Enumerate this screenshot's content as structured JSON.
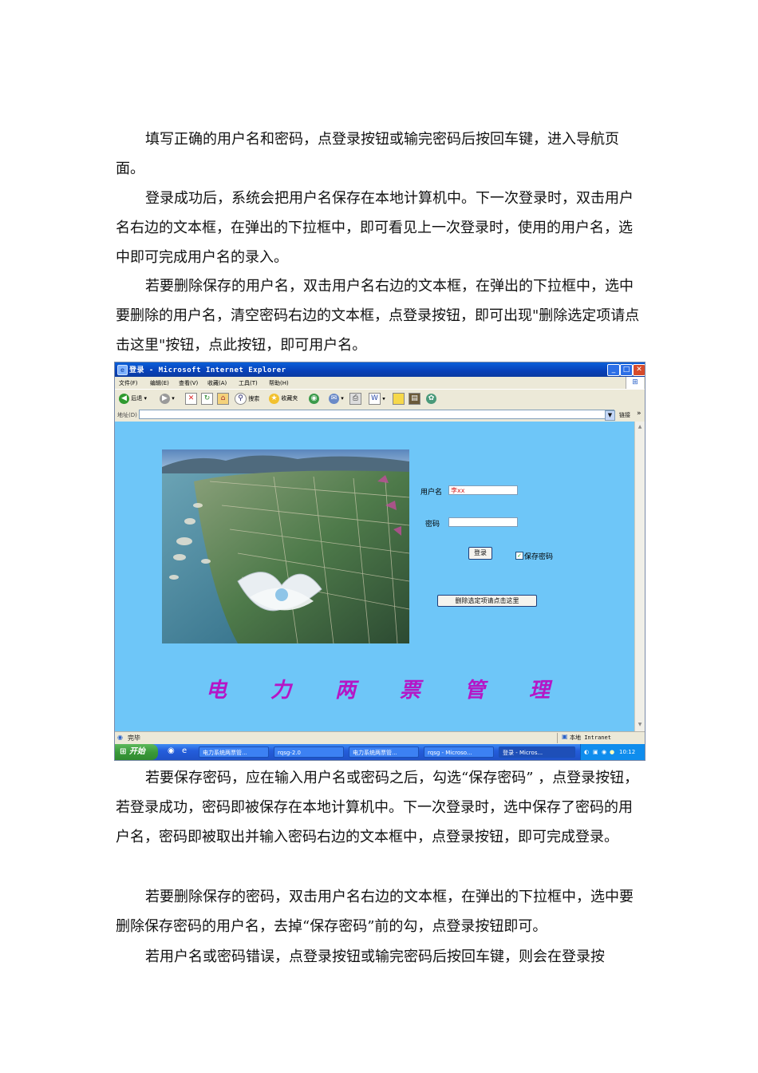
{
  "paragraphs": [
    "填写正确的用户名和密码，点登录按钮或输完密码后按回车键，进入导航页面。",
    "登录成功后，系统会把用户名保存在本地计算机中。下一次登录时，双击用户名右边的文本框，在弹出的下拉框中，即可看见上一次登录时，使用的用户名，选中即可完成用户名的录入。",
    "若要删除保存的用户名，双击用户名右边的文本框，在弹出的下拉框中，选中要删除的用户名，清空密码右边的文本框，点登录按钮，即可出现\"删除选定项请点击这里\"按钮，点此按钮，即可用户名。",
    "若要保存密码，应在输入用户名或密码之后，勾选“保存密码” ，点登录按钮，若登录成功，密码即被保存在本地计算机中。下一次登录时，选中保存了密码的用户名，密码即被取出并输入密码右边的文本框中，点登录按钮，即可完成登录。",
    "若要删除保存的密码，双击用户名右边的文本框，在弹出的下拉框中，选中要删除保存密码的用户名，去掉“保存密码”前的勾，点登录按钮即可。",
    "若用户名或密码错误，点登录按钮或输完密码后按回车键，则会在登录按"
  ],
  "browser": {
    "title": "登录 - Microsoft Internet Explorer",
    "menus": [
      "文件(F)",
      "编辑(E)",
      "查看(V)",
      "收藏(A)",
      "工具(T)",
      "帮助(H)"
    ],
    "toolbar": {
      "back": "后退",
      "search": "搜索",
      "favorites": "收藏夹"
    },
    "address_label": "地址(D)",
    "address_value": "",
    "go_label": "链接",
    "status_left": "完毕",
    "status_right": "本地 Intranet"
  },
  "login_page": {
    "username_label": "用户名",
    "username_value": "李xx",
    "password_label": "密码",
    "password_value": "",
    "login_button": "登录",
    "save_password_label": "保存密码",
    "save_password_checked": true,
    "delete_button": "删除选定项请点击这里",
    "slogan": [
      "电",
      "力",
      "两",
      "票",
      "管",
      "理"
    ]
  },
  "taskbar": {
    "start": "开始",
    "tasks": [
      "电力系统两票管...",
      "rqsg-2.0",
      "电力系统两票管...",
      "rqsg - Microso...",
      "登录 - Micros..."
    ],
    "clock": "10:12"
  },
  "colors": {
    "page_bg": "#6ec6f8",
    "slogan": "#b516c6",
    "username_text": "#d42222"
  }
}
